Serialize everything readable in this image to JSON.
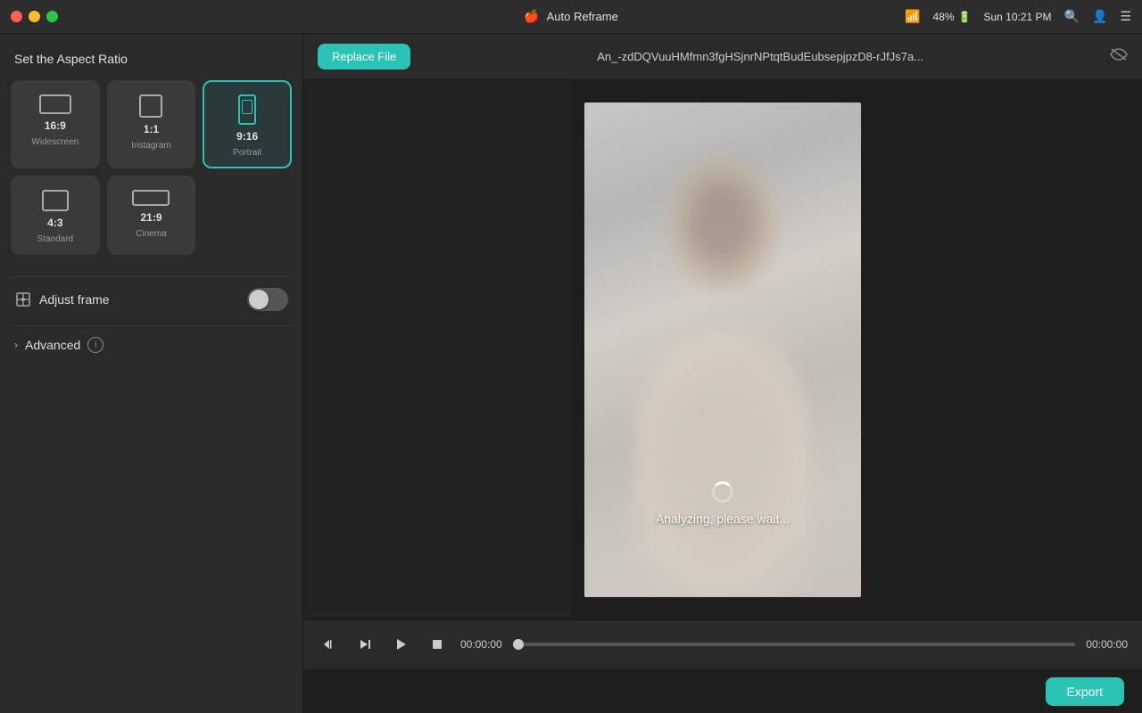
{
  "titlebar": {
    "app_name": "Auto Reframe",
    "clock": "Sun 10:21 PM",
    "battery_pct": "48%"
  },
  "sidebar": {
    "title": "Set the Aspect Ratio",
    "ratios": [
      {
        "id": "16-9",
        "ratio": "16:9",
        "label": "Widescreen",
        "active": false
      },
      {
        "id": "1-1",
        "ratio": "1:1",
        "label": "Instagram",
        "active": false
      },
      {
        "id": "9-16",
        "ratio": "9:16",
        "label": "Portrait",
        "active": true
      },
      {
        "id": "4-3",
        "ratio": "4:3",
        "label": "Standard",
        "active": false
      },
      {
        "id": "21-9",
        "ratio": "21:9",
        "label": "Cinema",
        "active": false
      }
    ],
    "adjust_frame_label": "Adjust frame",
    "toggle_state": "off",
    "advanced_label": "Advanced",
    "advanced_info_tooltip": "Advanced settings"
  },
  "topbar": {
    "replace_file_label": "Replace File",
    "filename": "An_-zdDQVuuHMfmn3fgHSjnrNPtqtBudEubsepjpzD8-rJfJs7a..."
  },
  "video": {
    "analyzing_text": "Analyzing, please wait..."
  },
  "playback": {
    "time_current": "00:00:00",
    "time_total": "00:00:00"
  },
  "footer": {
    "export_label": "Export"
  }
}
